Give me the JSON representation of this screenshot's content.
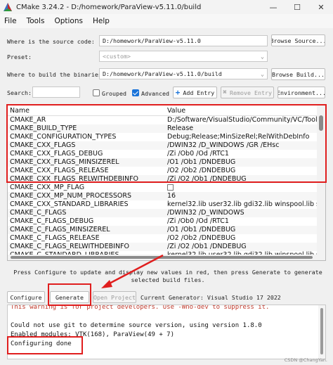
{
  "window": {
    "title": "CMake 3.24.2 - D:/homework/ParaView-v5.11.0/build",
    "minimize_glyph": "—",
    "maximize_glyph": "☐",
    "close_glyph": "✕"
  },
  "menu": [
    "File",
    "Tools",
    "Options",
    "Help"
  ],
  "source": {
    "label": "Where is the source code:",
    "value": "D:/homework/ParaView-v5.11.0",
    "button": "Browse Source..."
  },
  "preset": {
    "label": "Preset:",
    "value": "<custom>"
  },
  "build": {
    "label": "Where to build the binaries:",
    "value": "D:/homework/ParaView-v5.11.0/build",
    "button": "Browse Build..."
  },
  "search": {
    "label": "Search:",
    "value": "",
    "grouped_label": "Grouped",
    "advanced_label": "Advanced",
    "add_entry": "Add Entry",
    "remove_entry": "Remove Entry",
    "environment": "Environment..."
  },
  "table": {
    "headers": [
      "Name",
      "Value"
    ],
    "rows": [
      {
        "name": "CMAKE_AR",
        "value": "D:/Software/VisualStudio/Community/VC/Tools/..."
      },
      {
        "name": "CMAKE_BUILD_TYPE",
        "value": "Release"
      },
      {
        "name": "CMAKE_CONFIGURATION_TYPES",
        "value": "Debug;Release;MinSizeRel;RelWithDebInfo"
      },
      {
        "name": "CMAKE_CXX_FLAGS",
        "value": "/DWIN32 /D_WINDOWS /GR /EHsc"
      },
      {
        "name": "CMAKE_CXX_FLAGS_DEBUG",
        "value": "/Zi /Ob0 /Od /RTC1"
      },
      {
        "name": "CMAKE_CXX_FLAGS_MINSIZEREL",
        "value": "/O1 /Ob1 /DNDEBUG"
      },
      {
        "name": "CMAKE_CXX_FLAGS_RELEASE",
        "value": "/O2 /Ob2 /DNDEBUG"
      },
      {
        "name": "CMAKE_CXX_FLAGS_RELWITHDEBINFO",
        "value": "/Zi /O2 /Ob1 /DNDEBUG"
      },
      {
        "name": "CMAKE_CXX_MP_FLAG",
        "value": ""
      },
      {
        "name": "CMAKE_CXX_MP_NUM_PROCESSORS",
        "value": "16"
      },
      {
        "name": "CMAKE_CXX_STANDARD_LIBRARIES",
        "value": "kernel32.lib user32.lib gdi32.lib winspool.lib shell..."
      },
      {
        "name": "CMAKE_C_FLAGS",
        "value": "/DWIN32 /D_WINDOWS"
      },
      {
        "name": "CMAKE_C_FLAGS_DEBUG",
        "value": "/Zi /Ob0 /Od /RTC1"
      },
      {
        "name": "CMAKE_C_FLAGS_MINSIZEREL",
        "value": "/O1 /Ob1 /DNDEBUG"
      },
      {
        "name": "CMAKE_C_FLAGS_RELEASE",
        "value": "/O2 /Ob2 /DNDEBUG"
      },
      {
        "name": "CMAKE_C_FLAGS_RELWITHDEBINFO",
        "value": "/Zi /O2 /Ob1 /DNDEBUG"
      },
      {
        "name": "CMAKE_C_STANDARD_LIBRARIES",
        "value": "kernel32.lib user32.lib gdi32.lib winspool.lib shell..."
      }
    ]
  },
  "hint": "Press Configure to update and display new values in red, then press Generate to generate selected build files.",
  "actions": {
    "configure": "Configure",
    "generate": "Generate",
    "open_project": "Open Project",
    "generator": "Current Generator: Visual Studio 17 2022"
  },
  "log": [
    {
      "text": "This warning is for project developers.  Use -Wno-dev to suppress it.",
      "warn": true
    },
    {
      "text": "",
      "warn": false
    },
    {
      "text": "Could not use git to determine source version, using version 1.8.0",
      "warn": false
    },
    {
      "text": "Enabled modules: VTK(168), ParaView(49 + 7)",
      "warn": false
    },
    {
      "text": "Configuring done",
      "warn": false
    }
  ],
  "watermark": "CSDN @ChangYan.",
  "colors": {
    "highlight": "#e01e1e",
    "checkbox_on": "#1a73d9",
    "log_warning": "#c0392b"
  }
}
